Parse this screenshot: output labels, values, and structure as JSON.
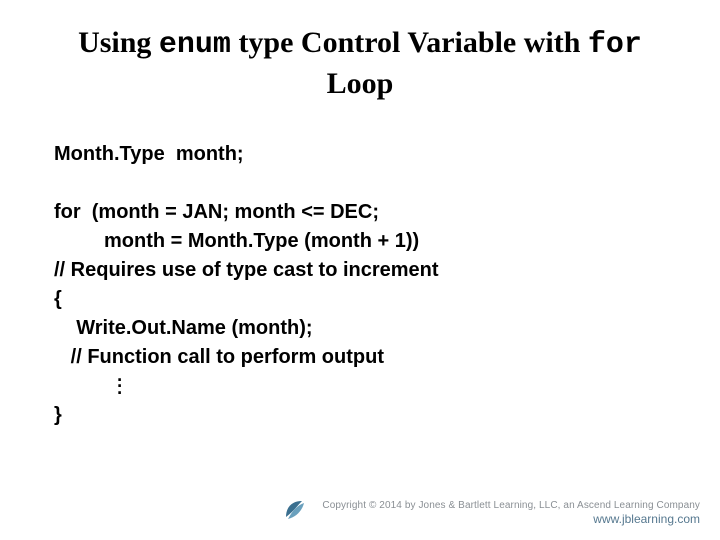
{
  "title": {
    "pre": "Using ",
    "enum": "enum",
    "mid": " type Control Variable with ",
    "for": "for",
    "post": " Loop"
  },
  "code": {
    "l1": "Month.Type  month;",
    "l2": "",
    "l3": "for  (month = JAN; month <= DEC;",
    "l4": "         month = Month.Type (month + 1))",
    "l5": "// Requires use of type cast to increment",
    "l6": "{",
    "l7": "    Write.Out.Name (month);",
    "l8": "   // Function call to perform output",
    "l9_prefix": "           ",
    "l10": "}"
  },
  "footer": {
    "copyright": "Copyright © 2014 by Jones & Bartlett Learning, LLC, an Ascend Learning Company",
    "url": "www.jblearning.com"
  }
}
